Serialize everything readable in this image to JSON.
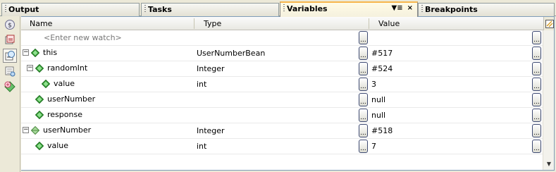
{
  "tabs": [
    {
      "label": "Output"
    },
    {
      "label": "Tasks"
    },
    {
      "label": "Variables"
    },
    {
      "label": "Breakpoints"
    }
  ],
  "tab_controls": {
    "menu": "▼≡",
    "close": "×"
  },
  "columns": {
    "name": "Name",
    "type": "Type",
    "value": "Value"
  },
  "ellipsis": "...",
  "rows": [
    {
      "name": "<Enter new watch>",
      "type": "",
      "value": ""
    },
    {
      "name": "this",
      "type": "UserNumberBean",
      "value": "#517"
    },
    {
      "name": "randomInt",
      "type": "Integer",
      "value": "#524"
    },
    {
      "name": "value",
      "type": "int",
      "value": "3"
    },
    {
      "name": "userNumber",
      "type": "",
      "value": "null"
    },
    {
      "name": "response",
      "type": "",
      "value": "null"
    },
    {
      "name": "userNumber",
      "type": "Integer",
      "value": "#518"
    },
    {
      "name": "value",
      "type": "int",
      "value": "7"
    }
  ],
  "icons": {
    "toolbar": [
      "watch-icon",
      "local-variables-icon",
      "filter-icon",
      "new-watch-icon"
    ],
    "field": "green-diamond-icon"
  },
  "colors": {
    "active_tab_accent": "#f7b64c",
    "field_icon": "#3aa337"
  }
}
